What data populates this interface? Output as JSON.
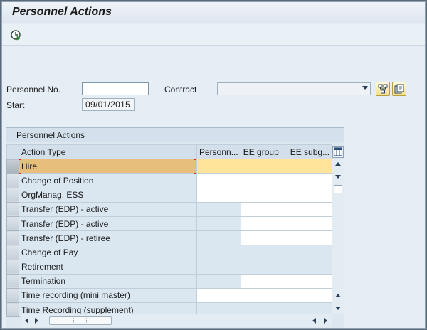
{
  "window": {
    "title": "Personnel Actions"
  },
  "toolbar": {
    "execute_icon": "execute-icon"
  },
  "form": {
    "personnel_no_label": "Personnel No.",
    "personnel_no_value": "",
    "contract_label": "Contract",
    "contract_value": "",
    "start_label": "Start",
    "start_value": "09/01/2015"
  },
  "actions": {
    "group_title": "Personnel Actions",
    "columns": [
      "Action Type",
      "Personn...",
      "EE group",
      "EE subg..."
    ],
    "rows": [
      "Hire",
      "Change of Position",
      "OrgManag. ESS",
      "Transfer (EDP) - active",
      "Transfer (EDP) - active",
      "Transfer (EDP) - retiree",
      "Change of Pay",
      "Retirement",
      "Termination",
      "Time recording (mini master)",
      "Time Recording (supplement)"
    ],
    "selected_row_index": 0
  },
  "colors": {
    "selected_row": "#ffe49a",
    "selected_name_cell": "#e8be7c",
    "accent_button": "#f3e08a"
  }
}
